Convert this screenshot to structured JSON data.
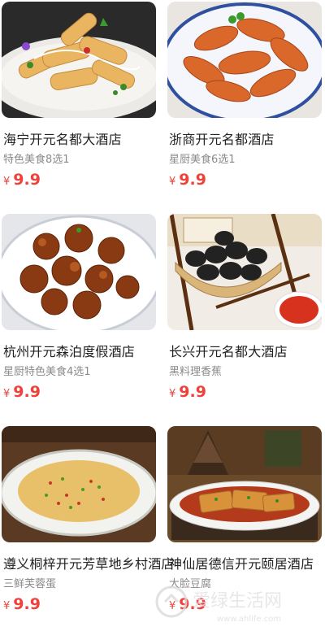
{
  "products": [
    {
      "name": "海宁开元名都大酒店",
      "subtitle": "特色美食8选1",
      "currency": "¥",
      "price": "9.9",
      "image": "fried-tofu-skin-rolls-dish"
    },
    {
      "name": "浙商开元名都酒店",
      "subtitle": "星厨美食6选1",
      "currency": "¥",
      "price": "9.9",
      "image": "braised-shrimp-dish"
    },
    {
      "name": "杭州开元森泊度假酒店",
      "subtitle": "星厨特色美食4选1",
      "currency": "¥",
      "price": "9.9",
      "image": "sweet-sour-pork-dish"
    },
    {
      "name": "长兴开元名都大酒店",
      "subtitle": "黑料理香蕉",
      "currency": "¥",
      "price": "9.9",
      "image": "black-banana-basket-dish"
    },
    {
      "name": "遵义桐梓开元芳草地乡村酒店",
      "subtitle": "三鲜芙蓉蛋",
      "currency": "¥",
      "price": "9.9",
      "image": "steamed-egg-custard-dish"
    },
    {
      "name": "神仙居德信开元颐居酒店",
      "subtitle": "大脸豆腐",
      "currency": "¥",
      "price": "9.9",
      "image": "braised-tofu-dish"
    }
  ],
  "watermark": {
    "text": "爱绿生活网",
    "url": "www.ahlife.com"
  },
  "colors": {
    "price": "#f0413b",
    "title": "#222222",
    "subtitle": "#8a8a8a"
  }
}
